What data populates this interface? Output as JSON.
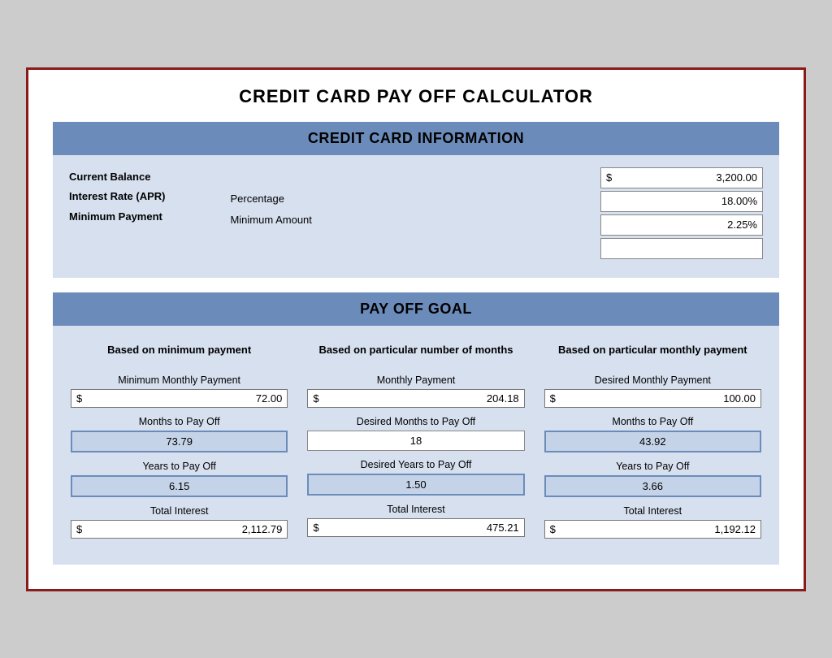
{
  "title": "CREDIT CARD PAY OFF CALCULATOR",
  "sections": {
    "credit_info": {
      "header": "CREDIT CARD INFORMATION",
      "labels": {
        "current_balance": "Current Balance",
        "interest_rate": "Interest Rate (APR)",
        "minimum_payment": "Minimum Payment"
      },
      "middle_labels": {
        "percentage": "Percentage",
        "minimum_amount": "Minimum Amount"
      },
      "values": {
        "current_balance": "3,200.00",
        "interest_rate": "18.00%",
        "min_payment_pct": "2.25%",
        "min_payment_amount": ""
      }
    },
    "payoff_goal": {
      "header": "PAY OFF GOAL",
      "columns": [
        {
          "header": "Based on minimum payment",
          "fields": [
            {
              "label": "Minimum Monthly Payment",
              "type": "dollar",
              "value": "72.00"
            },
            {
              "label": "Months to Pay Off",
              "type": "result",
              "value": "73.79"
            },
            {
              "label": "Years to Pay Off",
              "type": "result",
              "value": "6.15"
            },
            {
              "label": "Total Interest",
              "type": "dollar",
              "value": "2,112.79"
            }
          ]
        },
        {
          "header": "Based on particular number of months",
          "fields": [
            {
              "label": "Monthly Payment",
              "type": "dollar",
              "value": "204.18"
            },
            {
              "label": "Desired Months to Pay Off",
              "type": "result_white",
              "value": "18"
            },
            {
              "label": "Desired Years to Pay Off",
              "type": "result",
              "value": "1.50"
            },
            {
              "label": "Total Interest",
              "type": "dollar",
              "value": "475.21"
            }
          ]
        },
        {
          "header": "Based on particular monthly payment",
          "fields": [
            {
              "label": "Desired Monthly Payment",
              "type": "dollar",
              "value": "100.00"
            },
            {
              "label": "Months to Pay Off",
              "type": "result",
              "value": "43.92"
            },
            {
              "label": "Years to Pay Off",
              "type": "result",
              "value": "3.66"
            },
            {
              "label": "Total Interest",
              "type": "dollar",
              "value": "1,192.12"
            }
          ]
        }
      ]
    }
  }
}
